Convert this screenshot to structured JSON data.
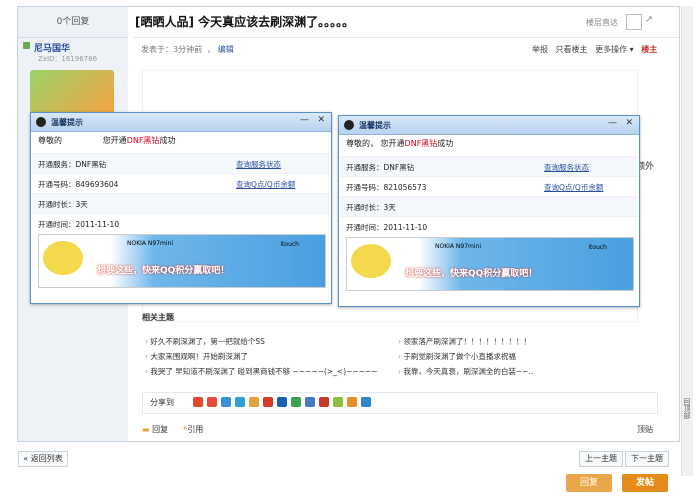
{
  "thread": {
    "reply_count": "0个回复",
    "title": "[晒晒人品] 今天真应该去刷深渊了。。。。。",
    "floor_go": "楼层直达"
  },
  "author": {
    "name": "尼马国华",
    "zxid": "ZxID：16196786"
  },
  "post": {
    "posted": "发表于：3分钟前",
    "edit": "编辑",
    "actions": [
      "举报",
      "只看楼主",
      "更多操作 ▾",
      "楼主"
    ],
    "side_text": "额外"
  },
  "popups": [
    {
      "title": "温馨提示",
      "greet_a": "尊敬的",
      "greet_b": "您开通",
      "service_name": "DNF黑钻",
      "greet_c": "成功",
      "rows": [
        {
          "label": "开通服务：DNF黑钻",
          "link": "查询服务状态"
        },
        {
          "label": "开通号码：849693604",
          "link": "查询Q点/Q币余额"
        },
        {
          "label": "开通时长：3天",
          "link": ""
        },
        {
          "label": "开通时间：2011-11-10",
          "link": ""
        }
      ],
      "banner_brand": "NOKIA N97mini",
      "banner_itouch": "itouch",
      "banner_slogan": "想要这些，快来QQ积分赢取吧！"
    },
    {
      "title": "温馨提示",
      "greet_a": "尊敬的，",
      "greet_b": "您开通",
      "service_name": "DNF黑钻",
      "greet_c": "成功",
      "rows": [
        {
          "label": "开通服务：DNF黑钻",
          "link": "查询服务状态"
        },
        {
          "label": "开通号码：821056573",
          "link": "查询Q点/Q币余额"
        },
        {
          "label": "开通时长：3天",
          "link": ""
        },
        {
          "label": "开通时间：2011-11-10",
          "link": ""
        }
      ],
      "banner_brand": "NOKIA N97mini",
      "banner_itouch": "itouch",
      "banner_slogan": "想要这些，快来QQ积分赢取吧！"
    }
  ],
  "related": {
    "title": "相关主题",
    "items": [
      "好久不刷深渊了，第一把就给个SS",
      "领家落产刷深渊了！！！！！！！！！",
      "大家来围观啊！开始刷深渊了",
      "于刷觉刷深渊了做个小直播求祝福",
      "我哭了 早知道不刷深渊了 碰到黑商钱不够 ~~~~~(>_<)~~~~~",
      "我靠，今天真衰，刷深渊全的白装~~.."
    ]
  },
  "share": {
    "label": "分享到"
  },
  "footer_post": {
    "reply": "回复",
    "quote": "引用",
    "report": "顶贴"
  },
  "nav": {
    "back": "« 返回列表",
    "prev": "上一主题",
    "next": "下一主题",
    "reply_btn": "回复",
    "post_btn": "发帖"
  },
  "scroll_side": "回顶部"
}
